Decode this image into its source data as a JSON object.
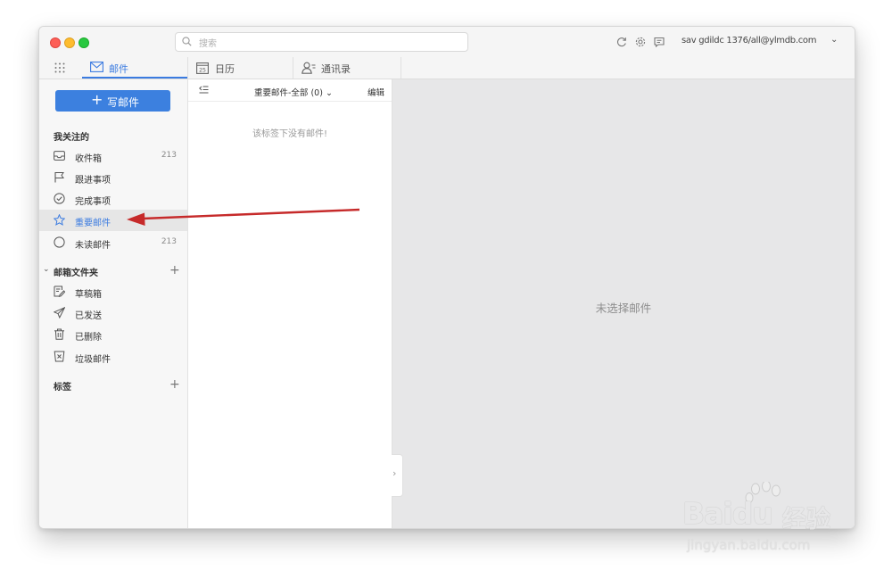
{
  "toolbar": {
    "search_placeholder": "搜索",
    "account": "sav gdildc 1376/all@ylmdb.com"
  },
  "tabs": [
    {
      "label": "邮件",
      "active": true
    },
    {
      "label": "日历",
      "date_badge": "25"
    },
    {
      "label": "通讯录"
    }
  ],
  "sidebar": {
    "compose_label": "写邮件",
    "favorites_title": "我关注的",
    "favorites": [
      {
        "label": "收件箱",
        "count": "213",
        "icon": "inbox-icon"
      },
      {
        "label": "跟进事项",
        "count": "",
        "icon": "flag-icon"
      },
      {
        "label": "完成事项",
        "count": "",
        "icon": "check-circle-icon"
      },
      {
        "label": "重要邮件",
        "count": "",
        "icon": "star-icon",
        "active": true
      },
      {
        "label": "未读邮件",
        "count": "213",
        "icon": "circle-icon"
      }
    ],
    "folders_title": "邮箱文件夹",
    "folders": [
      {
        "label": "草稿箱",
        "icon": "draft-icon"
      },
      {
        "label": "已发送",
        "icon": "send-icon"
      },
      {
        "label": "已删除",
        "icon": "trash-icon"
      },
      {
        "label": "垃圾邮件",
        "icon": "spam-icon"
      }
    ],
    "tags_title": "标签"
  },
  "message_list": {
    "title": "重要邮件-全部 (0)",
    "edit_label": "编辑",
    "empty_text": "该标签下没有邮件!"
  },
  "reading_pane": {
    "empty_text": "未选择邮件"
  },
  "colors": {
    "accent": "#3b7be0",
    "annotation_arrow": "#c62a2a"
  },
  "watermark": {
    "brand": "Baidu",
    "brand_cn": "经验",
    "url": "jingyan.baidu.com"
  }
}
